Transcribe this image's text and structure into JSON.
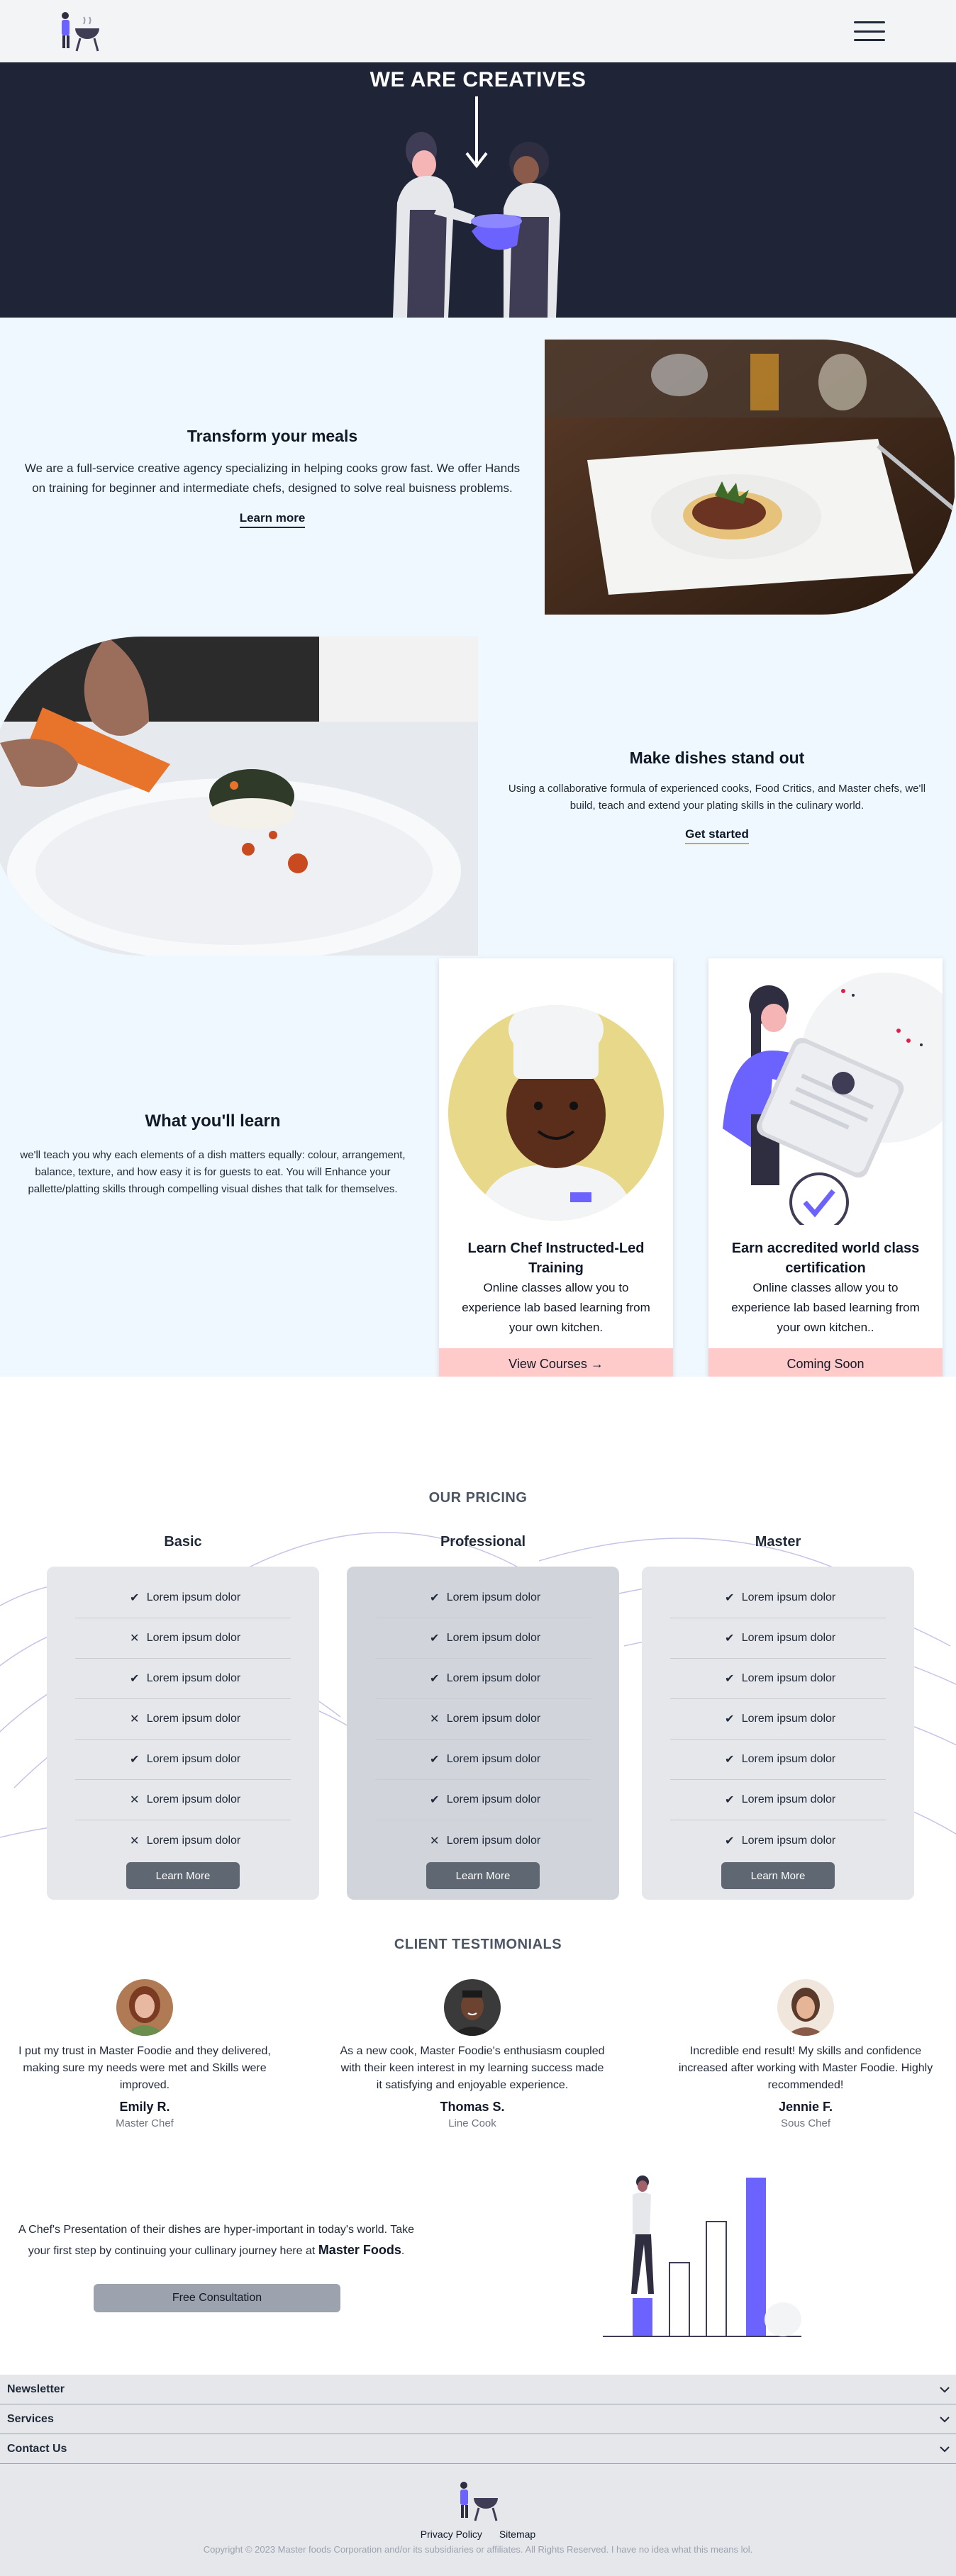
{
  "nav": {
    "menu_icon": "hamburger-icon",
    "logo_icon": "chef-grill-logo-icon"
  },
  "hero": {
    "title": "WE ARE CREATIVES",
    "bg_color": "#1f2537"
  },
  "feature1": {
    "title": "Transform your meals",
    "body": "We are a full-service creative agency specializing in helping cooks grow fast. We offer Hands on training for beginner and intermediate chefs, designed to solve real buisness problems.",
    "cta": "Learn more"
  },
  "feature2": {
    "title": "Make dishes stand out",
    "body": "Using a collaborative formula of experienced cooks, Food Critics, and Master chefs, we'll build, teach and extend your plating skills in the culinary world.",
    "cta": "Get started"
  },
  "learn": {
    "title": "What you'll learn",
    "body": "we'll teach you why each elements of a dish matters equally: colour, arrangement, balance, texture, and how easy it is for guests to eat. You will Enhance your pallette/platting skills through compelling visual dishes that talk for themselves.",
    "cards": [
      {
        "title": "Learn Chef Instructed-Led Training",
        "body": "Online classes allow you to experience lab based learning from your own kitchen.",
        "button": "View Courses →"
      },
      {
        "title": "Earn accredited world class certification",
        "body": "Online classes allow you to experience lab based learning from your own kitchen..",
        "button": "Coming Soon"
      }
    ]
  },
  "pricing": {
    "title": "OUR PRICING",
    "feature_label": "Lorem ipsum dolor",
    "button": "Learn More",
    "plans": [
      {
        "name": "Basic",
        "marks": [
          "✔",
          "✕",
          "✔",
          "✕",
          "✔",
          "✕",
          "✕"
        ]
      },
      {
        "name": "Professional",
        "marks": [
          "✔",
          "✔",
          "✔",
          "✕",
          "✔",
          "✔",
          "✕"
        ]
      },
      {
        "name": "Master",
        "marks": [
          "✔",
          "✔",
          "✔",
          "✔",
          "✔",
          "✔",
          "✔"
        ]
      }
    ]
  },
  "testimonials": {
    "title": "CLIENT TESTIMONIALS",
    "items": [
      {
        "quote": "I put my trust in Master Foodie and they delivered, making sure my needs were met and Skills were improved.",
        "name": "Emily R.",
        "role": "Master Chef"
      },
      {
        "quote": "As a new cook, Master Foodie's enthusiasm coupled with their keen interest in my learning success made it satisfying and enjoyable experience.",
        "name": "Thomas S.",
        "role": "Line Cook"
      },
      {
        "quote": "Incredible end result! My skills and confidence increased after working with Master Foodie. Highly recommended!",
        "name": "Jennie F.",
        "role": "Sous Chef"
      }
    ]
  },
  "cta": {
    "text": "A Chef's Presentation of their dishes are hyper-important in today's world. Take your first step by continuing your cullinary journey here at",
    "brand": "Master Foods",
    "text_end": ".",
    "button": "Free Consultation"
  },
  "accordion": [
    {
      "label": "Newsletter"
    },
    {
      "label": "Services"
    },
    {
      "label": "Contact Us"
    }
  ],
  "footer": {
    "links": [
      "Privacy Policy",
      "Sitemap"
    ],
    "copyright": "Copyright © 2023 Master foods Corporation and/or its subsidiaries or affiliates. All Rights Reserved. I have no idea what this means lol."
  },
  "colors": {
    "accent": "#6c63ff",
    "pink_button": "#fecaca",
    "light_bg": "#f0f8ff",
    "dark_bg": "#1f2537"
  }
}
